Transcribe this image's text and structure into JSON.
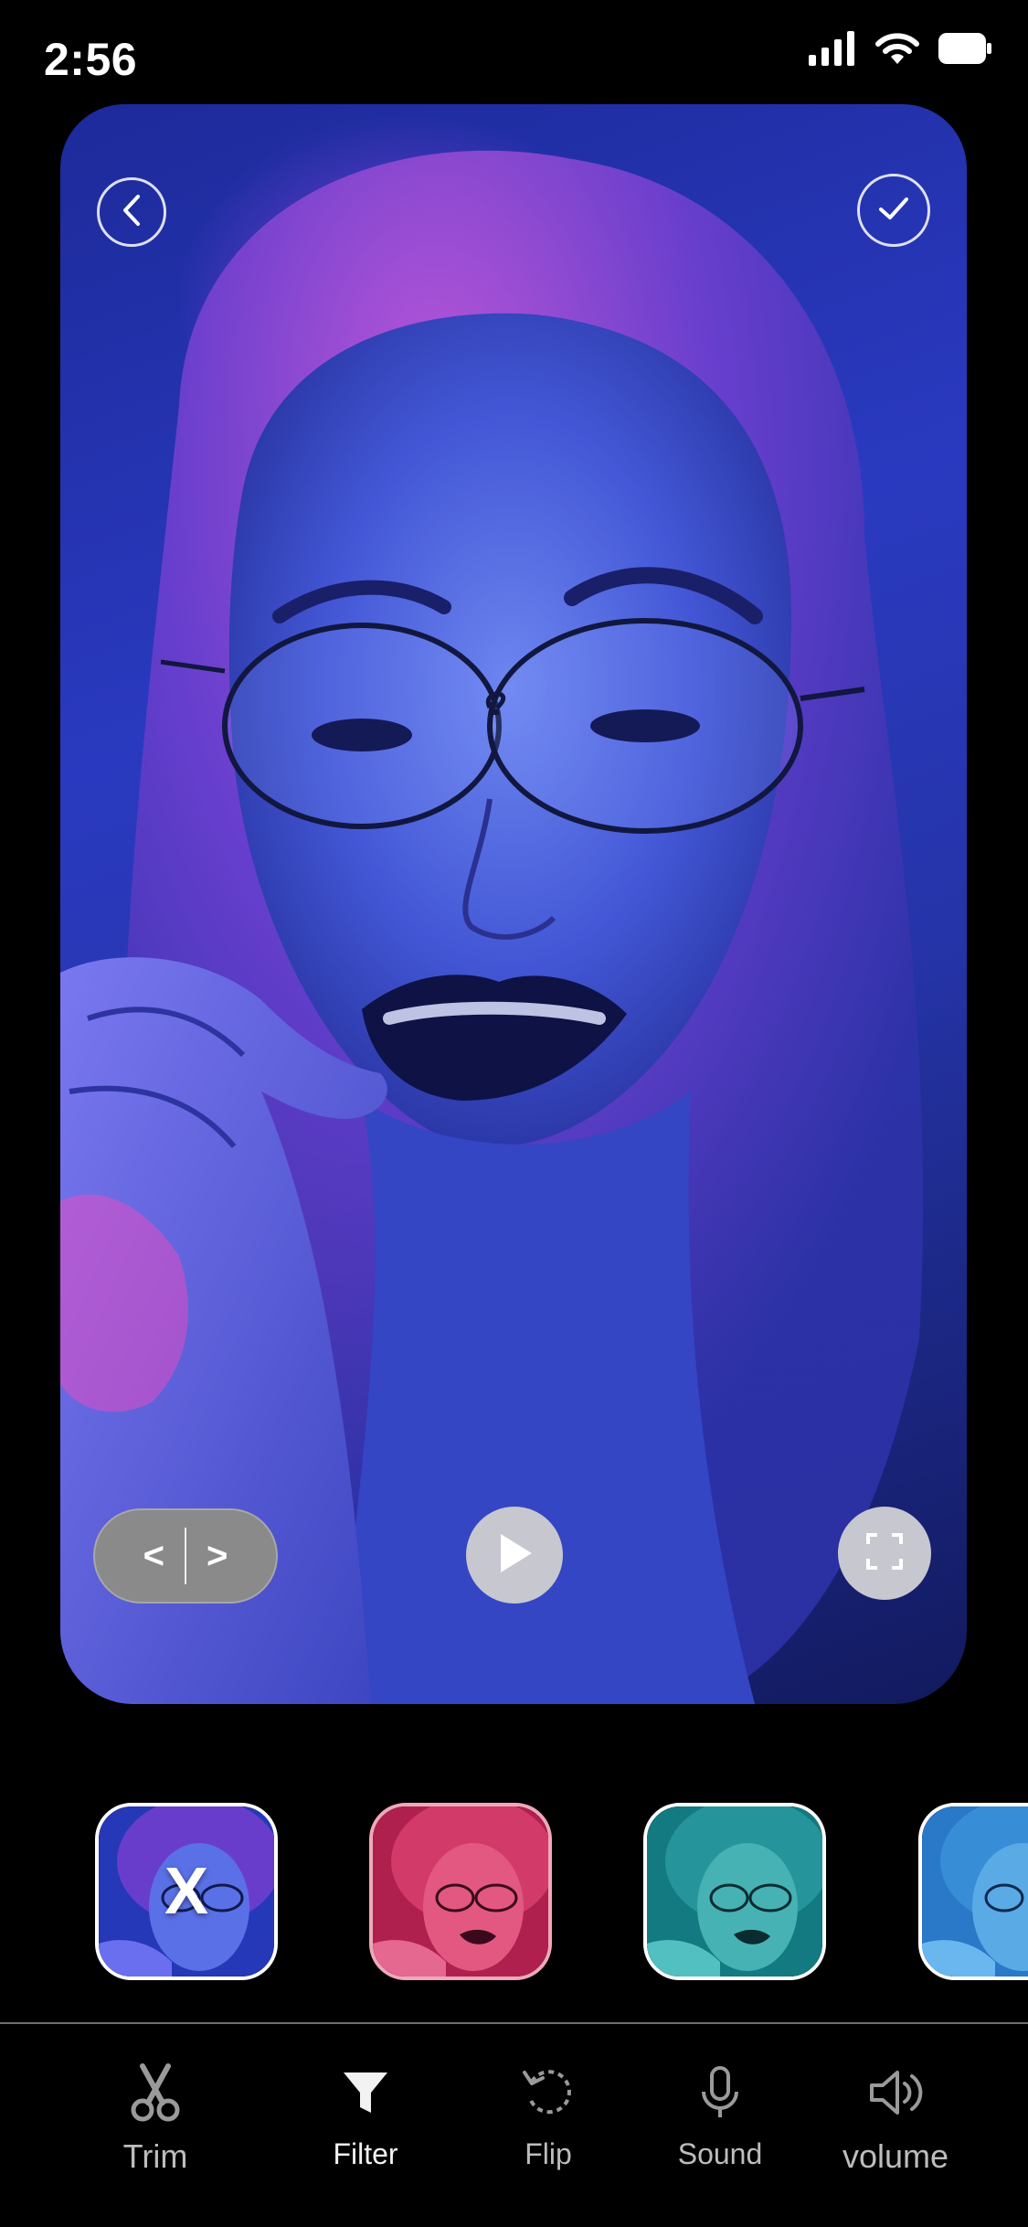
{
  "status_bar": {
    "time": "2:56",
    "icons": [
      "signal-icon",
      "wifi-icon",
      "battery-icon"
    ]
  },
  "preview": {
    "controls": {
      "back_icon": "chevron-left-icon",
      "confirm_icon": "checkmark-icon",
      "compare_left": "<",
      "compare_right": ">",
      "play_icon": "play-icon",
      "fullscreen_icon": "fullscreen-icon"
    }
  },
  "filters": [
    {
      "name": "none",
      "label": "X",
      "tint": "#2a3fc4",
      "selected": true
    },
    {
      "name": "pink",
      "tint": "#c0245c"
    },
    {
      "name": "teal",
      "tint": "#1a8d8f"
    },
    {
      "name": "cyan",
      "tint": "#2a78c8"
    }
  ],
  "toolbar": {
    "items": [
      {
        "label": "Trim",
        "icon": "scissors-icon"
      },
      {
        "label": "Filter",
        "icon": "filter-icon",
        "active": true
      },
      {
        "label": "Flip",
        "icon": "rotate-icon"
      },
      {
        "label": "Sound",
        "icon": "microphone-icon"
      },
      {
        "label": "volume",
        "icon": "speaker-icon"
      }
    ]
  },
  "colors": {
    "background": "#000000",
    "control_grey": "#c7c7cf",
    "pill_grey": "#8a8a8a",
    "thumb_border": "#ffffff",
    "divider": "#6e6e6e"
  }
}
